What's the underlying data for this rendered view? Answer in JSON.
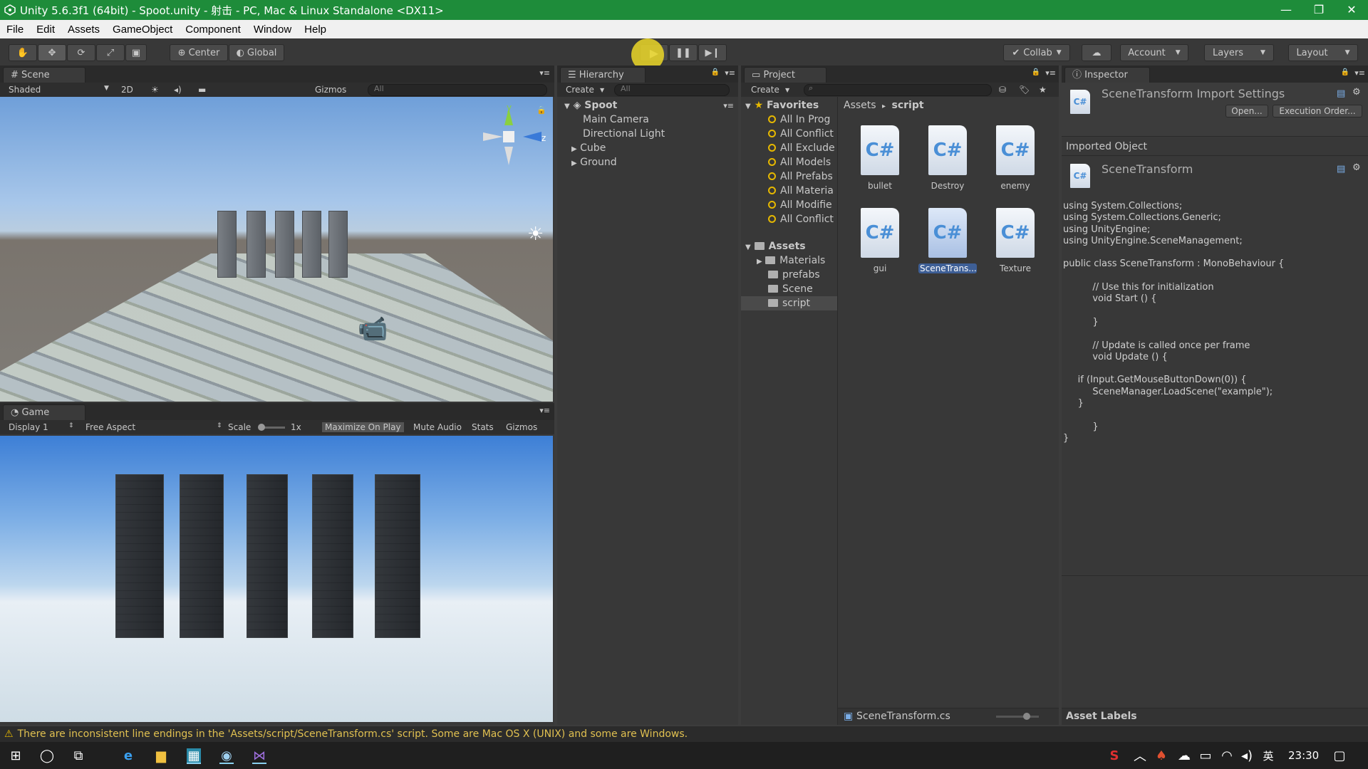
{
  "window": {
    "title": "Unity 5.6.3f1 (64bit) - Spoot.unity - 射击 - PC, Mac & Linux Standalone <DX11>",
    "minimize": "—",
    "maximize": "❐",
    "close": "✕"
  },
  "menu": [
    "File",
    "Edit",
    "Assets",
    "GameObject",
    "Component",
    "Window",
    "Help"
  ],
  "toolbar": {
    "pivot_label": "Center",
    "space_label": "Global",
    "collab_label": "Collab",
    "account_label": "Account",
    "layers_label": "Layers",
    "layout_label": "Layout"
  },
  "scene": {
    "tab": "Scene",
    "shading": "Shaded",
    "mode_2d": "2D",
    "gizmos": "Gizmos",
    "search_placeholder": "All",
    "axis_y": "y",
    "axis_z": "z"
  },
  "game": {
    "tab": "Game",
    "display": "Display 1",
    "aspect": "Free Aspect",
    "scale_label": "Scale",
    "scale_value": "1x",
    "maximize_on_play": "Maximize On Play",
    "mute_audio": "Mute Audio",
    "stats": "Stats",
    "gizmos": "Gizmos"
  },
  "hierarchy": {
    "tab": "Hierarchy",
    "create": "Create",
    "search_placeholder": "All",
    "scene_name": "Spoot",
    "items": [
      "Main Camera",
      "Directional Light",
      "Cube",
      "Ground"
    ]
  },
  "project": {
    "tab": "Project",
    "create": "Create",
    "favorites_label": "Favorites",
    "favorites": [
      "All In Prog",
      "All Conflict",
      "All Exclude",
      "All Models",
      "All Prefabs",
      "All Materia",
      "All Modifie",
      "All Conflict"
    ],
    "assets_label": "Assets",
    "folders": [
      "Materials",
      "prefabs",
      "Scene",
      "script"
    ],
    "breadcrumb_root": "Assets",
    "breadcrumb_sep": "▸",
    "breadcrumb_current": "script",
    "files": [
      "bullet",
      "Destroy",
      "enemy",
      "gui",
      "SceneTrans...",
      "Texture"
    ],
    "file_glyph": "C#",
    "selected_file": "SceneTransform.cs"
  },
  "inspector": {
    "tab": "Inspector",
    "title": "SceneTransform Import Settings",
    "open_button": "Open...",
    "exec_order_button": "Execution Order...",
    "imported_object_label": "Imported Object",
    "object_name": "SceneTransform",
    "code": "using System.Collections;\nusing System.Collections.Generic;\nusing UnityEngine;\nusing UnityEngine.SceneManagement;\n\npublic class SceneTransform : MonoBehaviour {\n\n\t\t// Use this for initialization\n\t\tvoid Start () {\n\t\t\n\t\t}\n\t\t\n\t\t// Update is called once per frame\n\t\tvoid Update () {\n\n\tif (Input.GetMouseButtonDown(0)) {\n\t\tSceneManager.LoadScene(\"example\");\n\t}\n\t\t\n\t\t}\n}",
    "asset_labels": "Asset Labels"
  },
  "status": {
    "message": "There are inconsistent line endings in the 'Assets/script/SceneTransform.cs' script. Some are Mac OS X (UNIX) and some are Windows."
  },
  "taskbar": {
    "ime": "英",
    "time": "23:30"
  },
  "colors": {
    "titlebar": "#1e8c3a",
    "panel": "#383838",
    "selection": "#3e5f96",
    "warning": "#e0c050"
  }
}
